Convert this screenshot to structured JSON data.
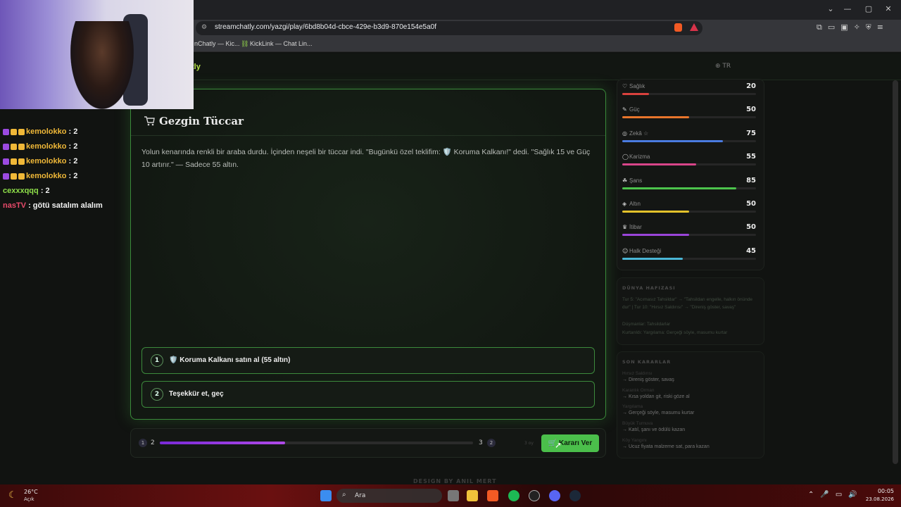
{
  "browser": {
    "url": "streamchatly.com/yazgi/play/6bd8b04d-cbce-429e-b3d9-870e154e5a0f",
    "bookmarks": [
      "nChatly — Kic...",
      "KickLink — Chat Lin..."
    ]
  },
  "site": {
    "brand": "tly",
    "lang": "TR"
  },
  "event": {
    "title": "Gezgin Tüccar",
    "text": "Yolun kenarında renkli bir araba durdu. İçinden neşeli bir tüccar indi. \"Bugünkü özel teklifim: 🛡️ Koruma Kalkanı!\" dedi. \"Sağlık 15 ve Güç 10 artırır.\" — Sadece 55 altın.",
    "choices": [
      {
        "num": "1",
        "label": "🛡️ Koruma Kalkanı satın al (55 altın)"
      },
      {
        "num": "2",
        "label": "Teşekkür et, geç"
      }
    ]
  },
  "progress": {
    "left_badge": "1",
    "left_count": "2",
    "right_count": "3",
    "right_badge": "2",
    "fill_fraction": 0.4,
    "note": "3 oy",
    "decide_label": "🛒 Kararı Ver"
  },
  "stats": [
    {
      "name": "Sağlık",
      "icon": "♡",
      "value": 20,
      "color": "#d9413d"
    },
    {
      "name": "Güç",
      "icon": "✎",
      "value": 50,
      "color": "#e8752b"
    },
    {
      "name": "Zekâ ☆",
      "icon": "◎",
      "value": 75,
      "color": "#4a7be0"
    },
    {
      "name": "Karizma",
      "icon": "◯",
      "value": 55,
      "color": "#d9458a"
    },
    {
      "name": "Şans",
      "icon": "☘",
      "value": 85,
      "color": "#4cc34c"
    },
    {
      "name": "Altın",
      "icon": "◈",
      "value": 50,
      "color": "#e3c22b"
    },
    {
      "name": "İtibar",
      "icon": "♛",
      "value": 50,
      "color": "#9a45d9"
    },
    {
      "name": "Halk Desteği",
      "icon": "☺",
      "value": 45,
      "color": "#4ab6d6"
    }
  ],
  "world_memory": {
    "title": "DÜNYA HAFIZASI",
    "lines": [
      "Tur 5: \"Acımasız Tahsildar\" → \"Tahsildarı engelle, halkın önünde dur\" | Tur 10: \"Hırsız Saldırısı\" → \"Direniş göster, savaş\"",
      "Düşmanlar: Tahsildarlar",
      "Kurtarıldı: Yargılama: Gerçeği söyle, masumu kurtar"
    ]
  },
  "recent_decisions": {
    "title": "SON KARARLAR",
    "items": [
      {
        "name": "Hırsız Saldırısı",
        "choice": "→ Direniş göster, savaş"
      },
      {
        "name": "Karanlık Orman",
        "choice": "→ Kısa yoldan git, riski göze al"
      },
      {
        "name": "Yargılama",
        "choice": "→ Gerçeği söyle, masumu kurtar"
      },
      {
        "name": "Büyük Turnuva",
        "choice": "→ Katıl, şanı ve ödülü kazan"
      },
      {
        "name": "Köy Yangını",
        "choice": "→ Ucuz fiyata malzeme sat, para kazan"
      }
    ]
  },
  "footer": {
    "credit": "DESIGN BY ANIL MERT"
  },
  "chat": [
    {
      "user": "kemolokko",
      "msg": ": 2",
      "badges": true
    },
    {
      "user": "kemolokko",
      "msg": ": 2",
      "badges": true
    },
    {
      "user": "kemolokko",
      "msg": ": 2",
      "badges": true
    },
    {
      "user": "kemolokko",
      "msg": ": 2",
      "badges": true
    },
    {
      "user": "cexxxqqq",
      "msg": ": 2",
      "badges": false,
      "color": "#8fe04a"
    },
    {
      "user": "nasTV",
      "msg": ": götü satalım alalım",
      "badges": false,
      "color": "#e84a6a"
    }
  ],
  "taskbar": {
    "temp": "26°C",
    "weather": "Açık",
    "search": "Ara",
    "time": "00:05",
    "date": "23.08.2026"
  }
}
